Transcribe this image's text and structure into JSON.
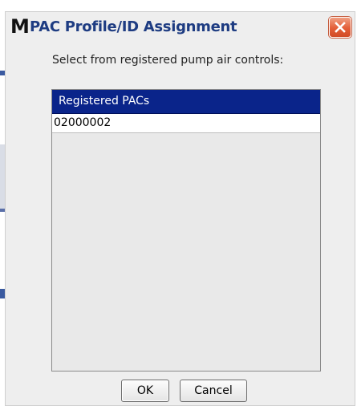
{
  "window": {
    "app_icon_letter": "M",
    "title": "PAC Profile/ID Assignment",
    "close_icon": "close-x-icon"
  },
  "prompt": "Select from registered pump air controls:",
  "list": {
    "header": "Registered PACs",
    "items": [
      "02000002"
    ]
  },
  "buttons": {
    "ok": "OK",
    "cancel": "Cancel"
  },
  "colors": {
    "title_text": "#1e3c82",
    "list_header_bg": "#0a248a",
    "close_button": "#e45f38"
  }
}
